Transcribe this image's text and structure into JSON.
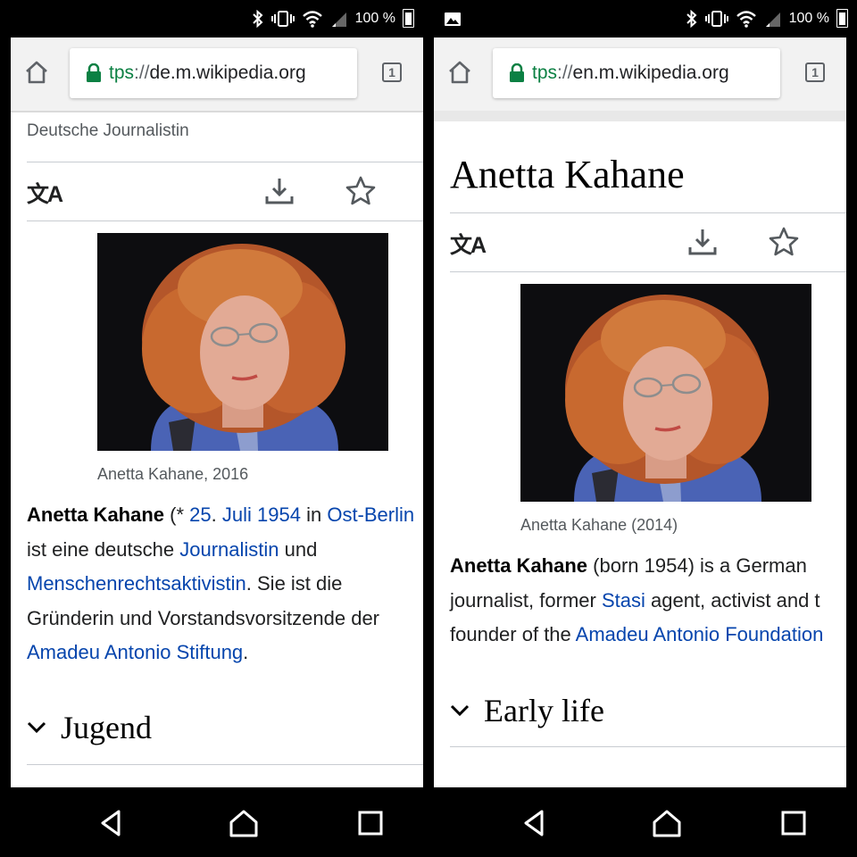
{
  "status_bar": {
    "battery": "100 %"
  },
  "screens": [
    {
      "url": {
        "scheme": "tps",
        "separator": "://",
        "host": "de.m.wikipedia.org"
      },
      "tab_count": "1",
      "subtitle": "Deutsche Journalistin",
      "caption": "Anetta Kahane, 2016",
      "lines": [
        [
          {
            "text": "Anetta Kahane",
            "type": "bold"
          },
          {
            "text": " (* ",
            "type": "text"
          },
          {
            "text": "25",
            "type": "link"
          },
          {
            "text": ". ",
            "type": "text"
          },
          {
            "text": "Juli 1954",
            "type": "link"
          },
          {
            "text": " in ",
            "type": "text"
          },
          {
            "text": "Ost-Berlin",
            "type": "link"
          }
        ],
        [
          {
            "text": "ist eine deutsche ",
            "type": "text"
          },
          {
            "text": "Journalistin",
            "type": "link"
          },
          {
            "text": " und",
            "type": "text"
          }
        ],
        [
          {
            "text": "Menschenrechtsaktivistin",
            "type": "link"
          },
          {
            "text": ". Sie ist die",
            "type": "text"
          }
        ],
        [
          {
            "text": "Gründerin und Vorstandsvorsitzende der",
            "type": "text"
          }
        ],
        [
          {
            "text": "Amadeu Antonio Stiftung",
            "type": "link"
          },
          {
            "text": ".",
            "type": "text"
          }
        ]
      ],
      "section": "Jugend"
    },
    {
      "url": {
        "scheme": "tps",
        "separator": "://",
        "host": "en.m.wikipedia.org"
      },
      "tab_count": "1",
      "title": "Anetta Kahane",
      "caption": "Anetta Kahane (2014)",
      "lines": [
        [
          {
            "text": "Anetta Kahane",
            "type": "bold"
          },
          {
            "text": " (born 1954) is a German",
            "type": "text"
          }
        ],
        [
          {
            "text": "journalist, former ",
            "type": "text"
          },
          {
            "text": "Stasi",
            "type": "link"
          },
          {
            "text": " agent, activist and t",
            "type": "text"
          }
        ],
        [
          {
            "text": "founder of the ",
            "type": "text"
          },
          {
            "text": "Amadeu Antonio Foundation",
            "type": "link"
          }
        ]
      ],
      "section": "Early life"
    }
  ],
  "icons": {
    "translate": "文A",
    "home": "home-icon",
    "download": "download-icon",
    "star": "star-icon",
    "lock": "lock-icon",
    "nav": [
      "back-icon",
      "home-icon",
      "recents-icon"
    ]
  },
  "colors": {
    "link": "#0645ad",
    "secure_scheme": "#0b8043",
    "text": "#202122",
    "muted": "#54595d"
  }
}
